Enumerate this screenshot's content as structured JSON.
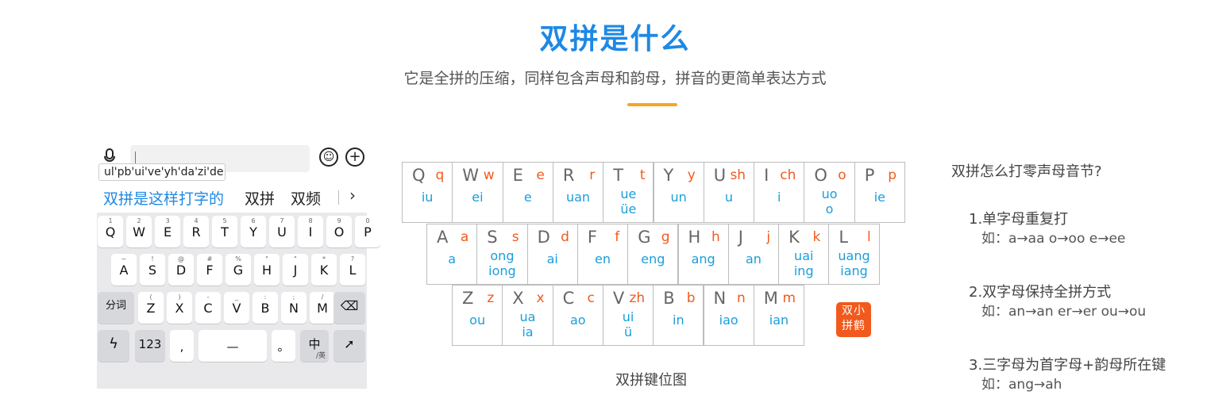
{
  "header": {
    "title": "双拼是什么",
    "subtitle": "它是全拼的压缩，同样包含声母和韵母，拼音的更简单表达方式"
  },
  "phone": {
    "pinyin_preview": "ul'pb'ui've'yh'da'zi'de",
    "candidates": [
      "双拼是这样打字的",
      "双拼",
      "双频"
    ],
    "rows": [
      [
        [
          "1",
          "Q"
        ],
        [
          "2",
          "W"
        ],
        [
          "3",
          "E"
        ],
        [
          "4",
          "R"
        ],
        [
          "5",
          "T"
        ],
        [
          "6",
          "Y"
        ],
        [
          "7",
          "U"
        ],
        [
          "8",
          "I"
        ],
        [
          "9",
          "O"
        ],
        [
          "0",
          "P"
        ]
      ],
      [
        [
          "~",
          "A"
        ],
        [
          "!",
          "S"
        ],
        [
          "@",
          "D"
        ],
        [
          "#",
          "F"
        ],
        [
          "%",
          "G"
        ],
        [
          "\"",
          "H"
        ],
        [
          "\"",
          "J"
        ],
        [
          "*",
          "K"
        ],
        [
          "?",
          "L"
        ]
      ],
      [
        [
          "(",
          "Z"
        ],
        [
          ")",
          "X"
        ],
        [
          "-",
          "C"
        ],
        [
          "_",
          "V"
        ],
        [
          ":",
          "B"
        ],
        [
          ";",
          "N"
        ],
        [
          "/",
          "M"
        ]
      ]
    ],
    "fn_keys": {
      "fenci": "分词",
      "num": "123",
      "comma": ",",
      "space": "—",
      "period": "。",
      "lang_main": "中",
      "lang_sub": "/英",
      "delete": "⌫"
    }
  },
  "keymap": {
    "rows": [
      [
        {
          "L": "Q",
          "S": "q",
          "Y": [
            "iu"
          ]
        },
        {
          "L": "W",
          "S": "w",
          "Y": [
            "ei"
          ]
        },
        {
          "L": "E",
          "S": "e",
          "Y": [
            "e"
          ]
        },
        {
          "L": "R",
          "S": "r",
          "Y": [
            "uan"
          ]
        },
        {
          "L": "T",
          "S": "t",
          "Y": [
            "ue",
            "üe"
          ]
        },
        {
          "L": "Y",
          "S": "y",
          "Y": [
            "un"
          ]
        },
        {
          "L": "U",
          "S": "sh",
          "Y": [
            "u"
          ]
        },
        {
          "L": "I",
          "S": "ch",
          "Y": [
            "i"
          ]
        },
        {
          "L": "O",
          "S": "o",
          "Y": [
            "uo",
            "o"
          ]
        },
        {
          "L": "P",
          "S": "p",
          "Y": [
            "ie"
          ]
        }
      ],
      [
        {
          "L": "A",
          "S": "a",
          "Y": [
            "a"
          ]
        },
        {
          "L": "S",
          "S": "s",
          "Y": [
            "ong",
            "iong"
          ]
        },
        {
          "L": "D",
          "S": "d",
          "Y": [
            "ai"
          ]
        },
        {
          "L": "F",
          "S": "f",
          "Y": [
            "en"
          ]
        },
        {
          "L": "G",
          "S": "g",
          "Y": [
            "eng"
          ]
        },
        {
          "L": "H",
          "S": "h",
          "Y": [
            "ang"
          ]
        },
        {
          "L": "J",
          "S": "j",
          "Y": [
            "an"
          ]
        },
        {
          "L": "K",
          "S": "k",
          "Y": [
            "uai",
            "ing"
          ]
        },
        {
          "L": "L",
          "S": "l",
          "Y": [
            "uang",
            "iang"
          ]
        }
      ],
      [
        {
          "L": "Z",
          "S": "z",
          "Y": [
            "ou"
          ]
        },
        {
          "L": "X",
          "S": "x",
          "Y": [
            "ua",
            "ia"
          ]
        },
        {
          "L": "C",
          "S": "c",
          "Y": [
            "ao"
          ]
        },
        {
          "L": "V",
          "S": "zh",
          "Y": [
            "ui",
            "ü"
          ]
        },
        {
          "L": "B",
          "S": "b",
          "Y": [
            "in"
          ]
        },
        {
          "L": "N",
          "S": "n",
          "Y": [
            "iao"
          ]
        },
        {
          "L": "M",
          "S": "m",
          "Y": [
            "ian"
          ]
        }
      ]
    ],
    "caption": "双拼键位图",
    "seal": [
      "双小",
      "拼鹤"
    ]
  },
  "rules": {
    "question": "双拼怎么打零声母音节?",
    "items": [
      {
        "heading": "1.单字母重复打",
        "example": "如：a→aa  o→oo  e→ee"
      },
      {
        "heading": "2.双字母保持全拼方式",
        "example": "如：an→an er→er ou→ou"
      },
      {
        "heading": "3.三字母为首字母+韵母所在键",
        "example": "如：ang→ah"
      }
    ]
  }
}
